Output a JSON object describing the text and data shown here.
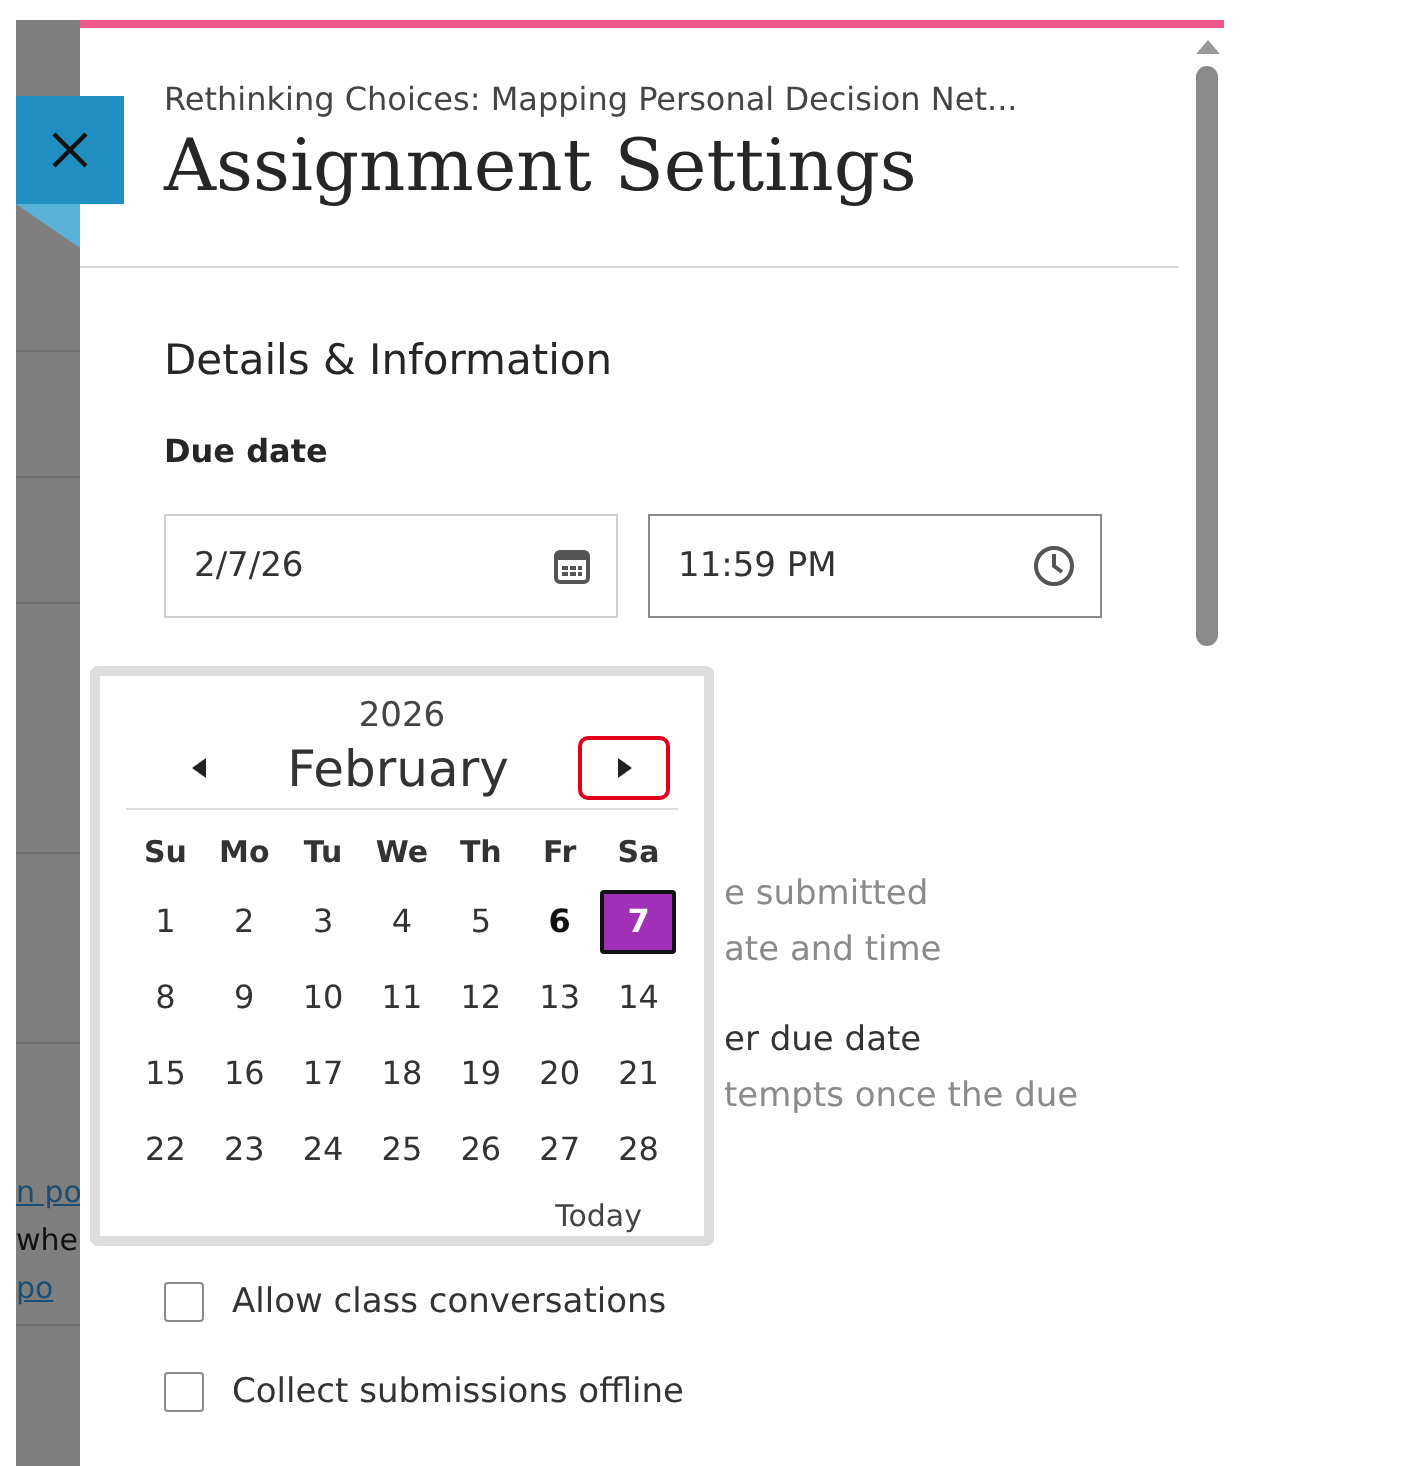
{
  "background_page": {
    "fragments": [
      {
        "text": "n po",
        "kind": "link"
      },
      {
        "text": "whe",
        "kind": "text"
      },
      {
        "text": "po",
        "kind": "link"
      }
    ]
  },
  "panel": {
    "subtitle": "Rethinking Choices: Mapping Personal Decision Net...",
    "title": "Assignment Settings",
    "section_title": "Details & Information",
    "due_date": {
      "label": "Due date",
      "date_value": "2/7/26",
      "time_value": "11:59 PM"
    },
    "covered_texts": [
      {
        "text": "e submitted",
        "kind": "hint"
      },
      {
        "text": "ate and time",
        "kind": "hint"
      },
      {
        "text": "er due date",
        "kind": "label"
      },
      {
        "text": "tempts once the due",
        "kind": "hint"
      }
    ],
    "options": [
      {
        "label": "Allow class conversations",
        "checked": false
      },
      {
        "label": "Collect submissions offline",
        "checked": false
      }
    ]
  },
  "calendar": {
    "year": "2026",
    "month": "February",
    "next_focused": true,
    "weekdays": [
      "Su",
      "Mo",
      "Tu",
      "We",
      "Th",
      "Fr",
      "Sa"
    ],
    "days": [
      {
        "label": "1",
        "today": false,
        "selected": false
      },
      {
        "label": "2",
        "today": false,
        "selected": false
      },
      {
        "label": "3",
        "today": false,
        "selected": false
      },
      {
        "label": "4",
        "today": false,
        "selected": false
      },
      {
        "label": "5",
        "today": false,
        "selected": false
      },
      {
        "label": "6",
        "today": true,
        "selected": false
      },
      {
        "label": "7",
        "today": false,
        "selected": true
      },
      {
        "label": "8",
        "today": false,
        "selected": false
      },
      {
        "label": "9",
        "today": false,
        "selected": false
      },
      {
        "label": "10",
        "today": false,
        "selected": false
      },
      {
        "label": "11",
        "today": false,
        "selected": false
      },
      {
        "label": "12",
        "today": false,
        "selected": false
      },
      {
        "label": "13",
        "today": false,
        "selected": false
      },
      {
        "label": "14",
        "today": false,
        "selected": false
      },
      {
        "label": "15",
        "today": false,
        "selected": false
      },
      {
        "label": "16",
        "today": false,
        "selected": false
      },
      {
        "label": "17",
        "today": false,
        "selected": false
      },
      {
        "label": "18",
        "today": false,
        "selected": false
      },
      {
        "label": "19",
        "today": false,
        "selected": false
      },
      {
        "label": "20",
        "today": false,
        "selected": false
      },
      {
        "label": "21",
        "today": false,
        "selected": false
      },
      {
        "label": "22",
        "today": false,
        "selected": false
      },
      {
        "label": "23",
        "today": false,
        "selected": false
      },
      {
        "label": "24",
        "today": false,
        "selected": false
      },
      {
        "label": "25",
        "today": false,
        "selected": false
      },
      {
        "label": "26",
        "today": false,
        "selected": false
      },
      {
        "label": "27",
        "today": false,
        "selected": false
      },
      {
        "label": "28",
        "today": false,
        "selected": false
      }
    ],
    "today_button": "Today"
  }
}
